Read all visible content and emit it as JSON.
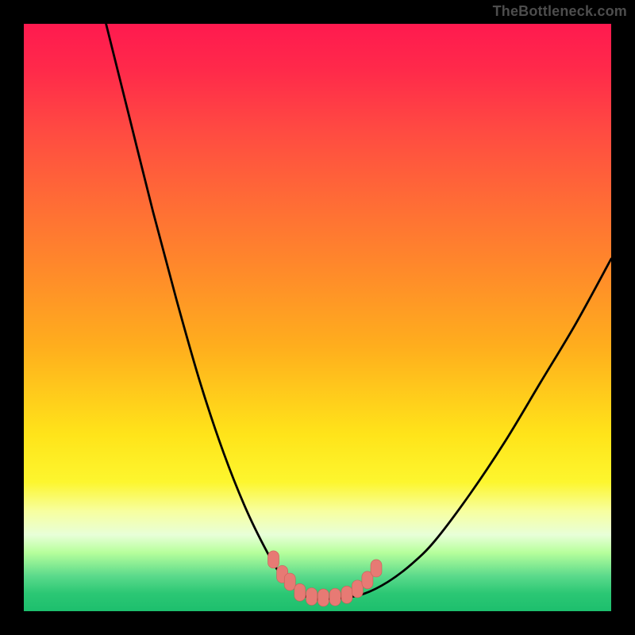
{
  "watermark": "TheBottleneck.com",
  "colors": {
    "frame": "#000000",
    "curve_stroke": "#000000",
    "marker_fill": "#e77a74",
    "marker_stroke": "#c95d57",
    "gradient_top": "#ff1a4f",
    "gradient_bottom": "#1dbf6d"
  },
  "chart_data": {
    "type": "line",
    "title": "",
    "xlabel": "",
    "ylabel": "",
    "xlim": [
      0,
      100
    ],
    "ylim": [
      0,
      100
    ],
    "series": [
      {
        "name": "bottleneck-curve-left",
        "x": [
          14,
          18,
          22,
          26,
          30,
          34,
          38,
          42,
          44,
          46,
          48,
          50
        ],
        "values": [
          100,
          84,
          68,
          53,
          39,
          27,
          17,
          9,
          6,
          4,
          2.5,
          2
        ]
      },
      {
        "name": "bottleneck-curve-right",
        "x": [
          50,
          54,
          58,
          62,
          66,
          70,
          76,
          82,
          88,
          94,
          100
        ],
        "values": [
          2,
          2.2,
          3,
          5,
          8,
          12,
          20,
          29,
          39,
          49,
          60
        ]
      }
    ],
    "markers": {
      "name": "optimal-region",
      "x": [
        42.5,
        44,
        45.3,
        47,
        49,
        51,
        53,
        55,
        56.8,
        58.5,
        60
      ],
      "values": [
        8.8,
        6.3,
        5.0,
        3.2,
        2.5,
        2.3,
        2.4,
        2.8,
        3.8,
        5.3,
        7.3
      ]
    }
  }
}
